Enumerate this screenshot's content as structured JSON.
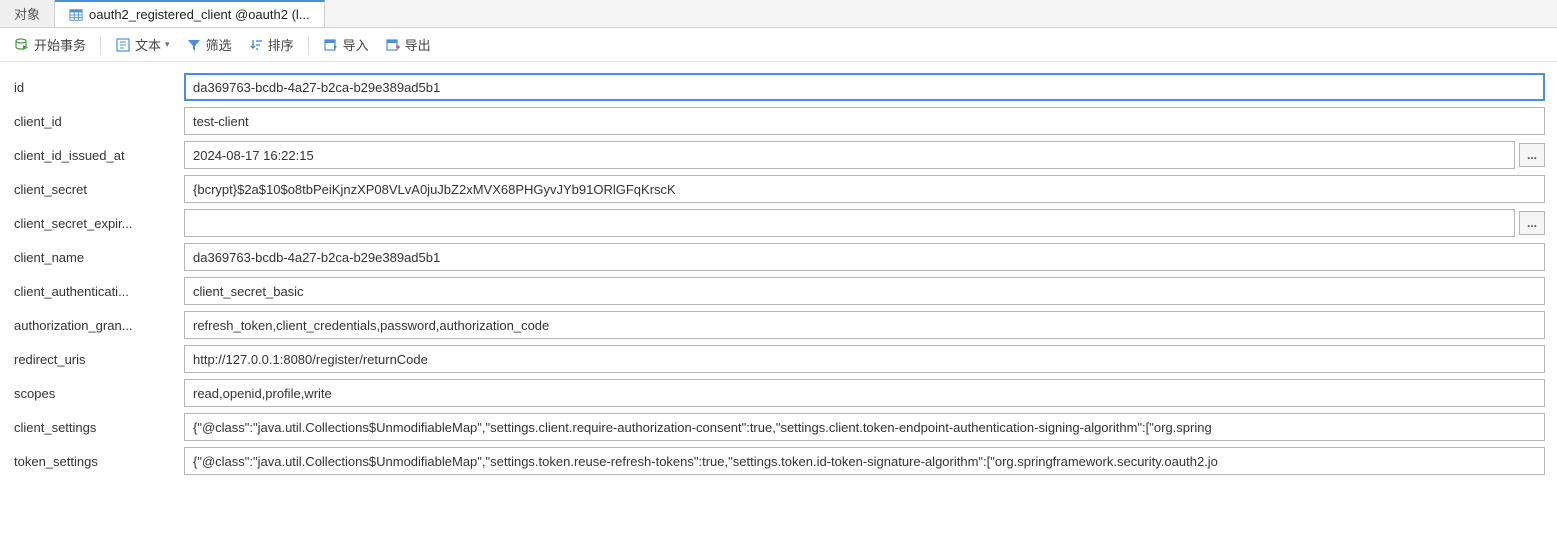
{
  "tabs": {
    "objects": "对象",
    "active": "oauth2_registered_client @oauth2 (l..."
  },
  "toolbar": {
    "begin_tx": "开始事务",
    "text": "文本",
    "filter": "筛选",
    "sort": "排序",
    "import": "导入",
    "export": "导出"
  },
  "rows": [
    {
      "key": "id",
      "label": "id",
      "value": "da369763-bcdb-4a27-b2ca-b29e389ad5b1",
      "ellipsis": false,
      "active": true
    },
    {
      "key": "client_id",
      "label": "client_id",
      "value": "test-client",
      "ellipsis": false
    },
    {
      "key": "client_id_issued_at",
      "label": "client_id_issued_at",
      "value": "2024-08-17 16:22:15",
      "ellipsis": true
    },
    {
      "key": "client_secret",
      "label": "client_secret",
      "value": "{bcrypt}$2a$10$o8tbPeiKjnzXP08VLvA0juJbZ2xMVX68PHGyvJYb91ORlGFqKrscK",
      "ellipsis": false
    },
    {
      "key": "client_secret_expires_at",
      "label": "client_secret_expir...",
      "value": "",
      "ellipsis": true
    },
    {
      "key": "client_name",
      "label": "client_name",
      "value": "da369763-bcdb-4a27-b2ca-b29e389ad5b1",
      "ellipsis": false
    },
    {
      "key": "client_authentication_methods",
      "label": "client_authenticati...",
      "value": "client_secret_basic",
      "ellipsis": false
    },
    {
      "key": "authorization_grant_types",
      "label": "authorization_gran...",
      "value": "refresh_token,client_credentials,password,authorization_code",
      "ellipsis": false
    },
    {
      "key": "redirect_uris",
      "label": "redirect_uris",
      "value": "http://127.0.0.1:8080/register/returnCode",
      "ellipsis": false
    },
    {
      "key": "scopes",
      "label": "scopes",
      "value": "read,openid,profile,write",
      "ellipsis": false
    },
    {
      "key": "client_settings",
      "label": "client_settings",
      "value": "{\"@class\":\"java.util.Collections$UnmodifiableMap\",\"settings.client.require-authorization-consent\":true,\"settings.client.token-endpoint-authentication-signing-algorithm\":[\"org.spring",
      "ellipsis": false
    },
    {
      "key": "token_settings",
      "label": "token_settings",
      "value": "{\"@class\":\"java.util.Collections$UnmodifiableMap\",\"settings.token.reuse-refresh-tokens\":true,\"settings.token.id-token-signature-algorithm\":[\"org.springframework.security.oauth2.jo",
      "ellipsis": false
    }
  ],
  "ellipsis_label": "..."
}
